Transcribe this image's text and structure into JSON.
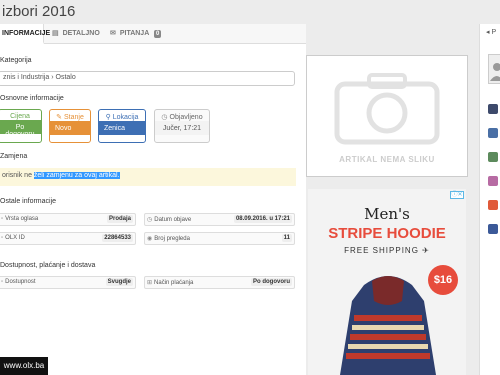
{
  "title": "izbori 2016",
  "tabs": [
    {
      "label": "INFORMACIJE"
    },
    {
      "label": "DETALJNO"
    },
    {
      "label": "PITANJA",
      "badge": "0"
    }
  ],
  "category": {
    "heading": "Kategorija",
    "path": "znis i Industrija  ›  Ostalo"
  },
  "basic": {
    "heading": "Osnovne informacije",
    "price": {
      "label": "Cijena",
      "value": "Po dogovoru",
      "color": "#6aa84f"
    },
    "state": {
      "label": "Stanje",
      "value": "Novo",
      "color": "#e69138"
    },
    "location": {
      "label": "Lokacija",
      "value": "Zenica",
      "color": "#3d6fb4"
    },
    "published": {
      "label": "Objavljeno",
      "value": "Jučer, 17:21"
    }
  },
  "exchange": {
    "heading": "Zamjena",
    "prefix": "orisnik ne ",
    "highlight": "želi zamjenu za ovaj artikal."
  },
  "other": {
    "heading": "Ostale informacije",
    "rows": [
      {
        "k": "Vrsta oglasa",
        "v": "Prodaja"
      },
      {
        "k": "Datum objave",
        "v": "08.09.2016. u 17:21"
      },
      {
        "k": "OLX ID",
        "v": "22864533"
      },
      {
        "k": "Broj pregleda",
        "v": "11"
      }
    ]
  },
  "delivery": {
    "heading": "Dostupnost, plaćanje i dostava",
    "rows": [
      {
        "k": "Dostupnost",
        "v": "Svugdje"
      },
      {
        "k": "Način plaćanja",
        "v": "Po dogovoru"
      }
    ]
  },
  "no_image": "ARTIKAL NEMA SLIKU",
  "ad": {
    "line1": "Men's",
    "line2": "STRIPE HOODIE",
    "line3": "FREE SHIPPING",
    "price": "$16"
  },
  "sidebar": {
    "label": "P"
  },
  "footer": "www.olx.ba"
}
